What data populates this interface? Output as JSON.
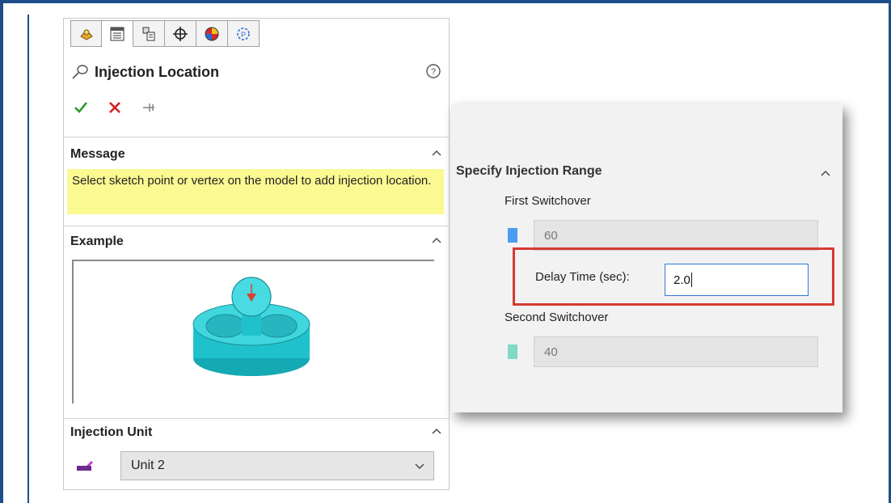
{
  "panel": {
    "tabs": [
      {
        "name": "feature-manager-tab",
        "icon": "feature-tree-icon"
      },
      {
        "name": "property-manager-tab",
        "icon": "property-manager-icon"
      },
      {
        "name": "configuration-manager-tab",
        "icon": "configuration-icon"
      },
      {
        "name": "dimxpert-manager-tab",
        "icon": "crosshair-icon"
      },
      {
        "name": "display-manager-tab",
        "icon": "appearance-sphere-icon"
      },
      {
        "name": "plastics-manager-tab",
        "icon": "plastics-icon"
      }
    ],
    "title": "Injection Location",
    "message": {
      "header": "Message",
      "text": "Select sketch point or vertex on the model to add injection location."
    },
    "example": {
      "header": "Example"
    },
    "injection_unit": {
      "header": "Injection Unit",
      "selected": "Unit 2"
    }
  },
  "popup": {
    "header": "Specify Injection Range",
    "first_switchover_label": "First Switchover",
    "first_switchover_value": "60",
    "delay_time_label": "Delay Time (sec):",
    "delay_time_value": "2.0",
    "second_switchover_label": "Second Switchover",
    "second_switchover_value": "40"
  },
  "colors": {
    "accept": "#2e9b2e",
    "cancel": "#d52020",
    "highlight": "#d63a32",
    "message_bg": "#fbf991",
    "model": "#1fc2cc"
  }
}
